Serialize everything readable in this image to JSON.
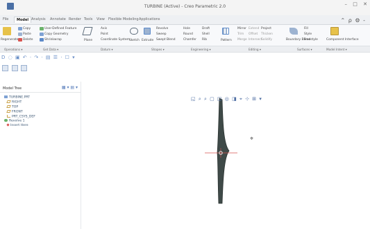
{
  "window": {
    "title": "TURBINE (Active) - Creo Parametric 2.0",
    "controls": [
      "–",
      "□",
      "✕"
    ]
  },
  "tabs": [
    {
      "label": "File",
      "active": false
    },
    {
      "label": "Model",
      "active": true
    },
    {
      "label": "Analysis",
      "active": false
    },
    {
      "label": "Annotate",
      "active": false
    },
    {
      "label": "Render",
      "active": false
    },
    {
      "label": "Tools",
      "active": false
    },
    {
      "label": "View",
      "active": false
    },
    {
      "label": "Flexible Modeling",
      "active": false
    },
    {
      "label": "Applications",
      "active": false
    }
  ],
  "ribbon_right_icons": "⌃ ρ ⚙ -",
  "ribbon": {
    "regenerate": "Regenerate",
    "copy": "Copy",
    "paste": "Paste",
    "delete": "Delete",
    "user_defined_feature": "User-Defined Feature",
    "copy_geometry": "Copy Geometry",
    "shrinkwrap": "Shrinkwrap",
    "plane": "Plane",
    "axis": "Axis",
    "point": "Point",
    "coordinate_system": "Coordinate System",
    "sketch": "Sketch",
    "extrude": "Extrude",
    "revolve": "Revolve",
    "sweep": "Sweep",
    "swept_blend": "Swept Blend",
    "hole": "Hole",
    "round": "Round",
    "chamfer": "Chamfer",
    "draft": "Draft",
    "shell": "Shell",
    "rib": "Rib",
    "pattern": "Pattern",
    "mirror": "Mirror",
    "extend": "Extend",
    "project": "Project",
    "trim": "Trim",
    "offset": "Offset",
    "thicken": "Thicken",
    "merge": "Merge",
    "intersect": "Intersect",
    "solidify": "Solidify",
    "boundary_blend": "Boundary Blend",
    "fill": "Fill",
    "style": "Style",
    "freestyle": "Freestyle",
    "component_interface": "Component Interface"
  },
  "groups": [
    "Operations ▾",
    "Get Data ▾",
    "Datum ▾",
    "Shapes ▾",
    "Engineering ▾",
    "Editing ▾",
    "Surfaces ▾",
    "Model Intent ▾"
  ],
  "quick_access": "D ◌ ▣ ↶ · ↷ · ▤ ☰ · ☐ ▾",
  "model_tree": {
    "title": "Model Tree",
    "tools": "▦ ▾ ▤ ▾",
    "nodes": [
      {
        "label": "TURBINE.PRT",
        "icon": "part",
        "indent": 0
      },
      {
        "label": "RIGHT",
        "icon": "datum-plane",
        "indent": 1
      },
      {
        "label": "TOP",
        "icon": "datum-plane",
        "indent": 1
      },
      {
        "label": "FRONT",
        "icon": "datum-plane",
        "indent": 1
      },
      {
        "label": "PRT_CSYS_DEF",
        "icon": "csys",
        "indent": 1
      },
      {
        "label": "Revolve 1",
        "icon": "revolve",
        "indent": 0
      },
      {
        "label": "Insert Here",
        "icon": "insert",
        "indent": 1
      }
    ]
  },
  "view_toolbar": "◱ ⌕ ⌕ ▢ ◫ ◎ ◨ ⌖ ⊹ ⊞ ▾",
  "cursor": "⌖",
  "colors": {
    "accent": "#4e6ea3",
    "model": "#3f4a48",
    "axis": "#d9534f"
  }
}
